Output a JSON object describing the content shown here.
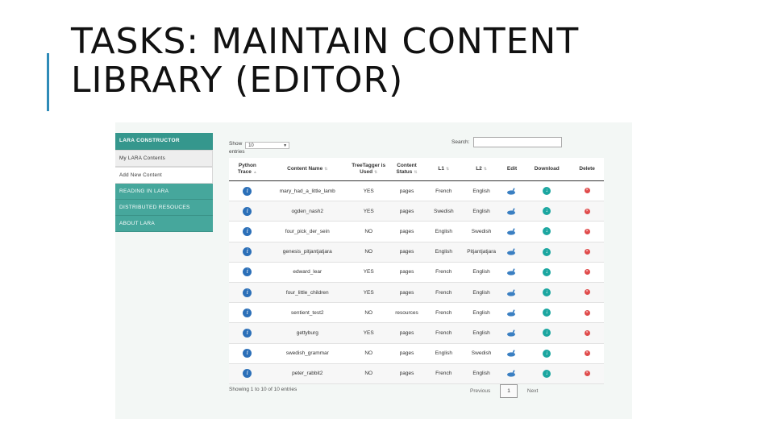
{
  "slide": {
    "title": "TASKS: MAINTAIN CONTENT LIBRARY (EDITOR)"
  },
  "sidebar": {
    "header": "LARA CONSTRUCTOR",
    "subitems": [
      "My LARA Contents",
      "Add New Content"
    ],
    "items": [
      "READING IN LARA",
      "DISTRIBUTED RESOUCES",
      "ABOUT LARA"
    ]
  },
  "controls": {
    "show_label": "Show",
    "show_value": "10",
    "entries_label": "entries",
    "search_label": "Search:"
  },
  "table": {
    "headers": [
      "Python Trace",
      "Content Name",
      "TreeTagger is Used",
      "Content Status",
      "L1",
      "L2",
      "Edit",
      "Download",
      "Delete"
    ],
    "rows": [
      {
        "name": "mary_had_a_little_lamb",
        "tagger": "YES",
        "status": "pages",
        "l1": "French",
        "l2": "English"
      },
      {
        "name": "ogden_nash2",
        "tagger": "YES",
        "status": "pages",
        "l1": "Swedish",
        "l2": "English"
      },
      {
        "name": "four_pick_der_sein",
        "tagger": "NO",
        "status": "pages",
        "l1": "English",
        "l2": "Swedish"
      },
      {
        "name": "genesis_pitjantjatjara",
        "tagger": "NO",
        "status": "pages",
        "l1": "English",
        "l2": "Pitjantjatjara"
      },
      {
        "name": "edward_lear",
        "tagger": "YES",
        "status": "pages",
        "l1": "French",
        "l2": "English"
      },
      {
        "name": "four_little_children",
        "tagger": "YES",
        "status": "pages",
        "l1": "French",
        "l2": "English"
      },
      {
        "name": "sentient_test2",
        "tagger": "NO",
        "status": "resources",
        "l1": "French",
        "l2": "English"
      },
      {
        "name": "gettyburg",
        "tagger": "YES",
        "status": "pages",
        "l1": "French",
        "l2": "English"
      },
      {
        "name": "swedish_grammar",
        "tagger": "NO",
        "status": "pages",
        "l1": "English",
        "l2": "Swedish"
      },
      {
        "name": "peter_rabbit2",
        "tagger": "NO",
        "status": "pages",
        "l1": "French",
        "l2": "English"
      }
    ]
  },
  "pagination": {
    "info": "Showing 1 to 10 of 10 entries",
    "previous": "Previous",
    "current": "1",
    "next": "Next"
  },
  "icons": {
    "python_trace": "python-trace-icon",
    "edit": "edit-icon",
    "download": "download-icon",
    "delete": "delete-icon"
  },
  "colors": {
    "sidebar": "#46a79c",
    "accent": "#2e8bb8",
    "download": "#1ba6a0",
    "delete": "#e04a4a"
  }
}
